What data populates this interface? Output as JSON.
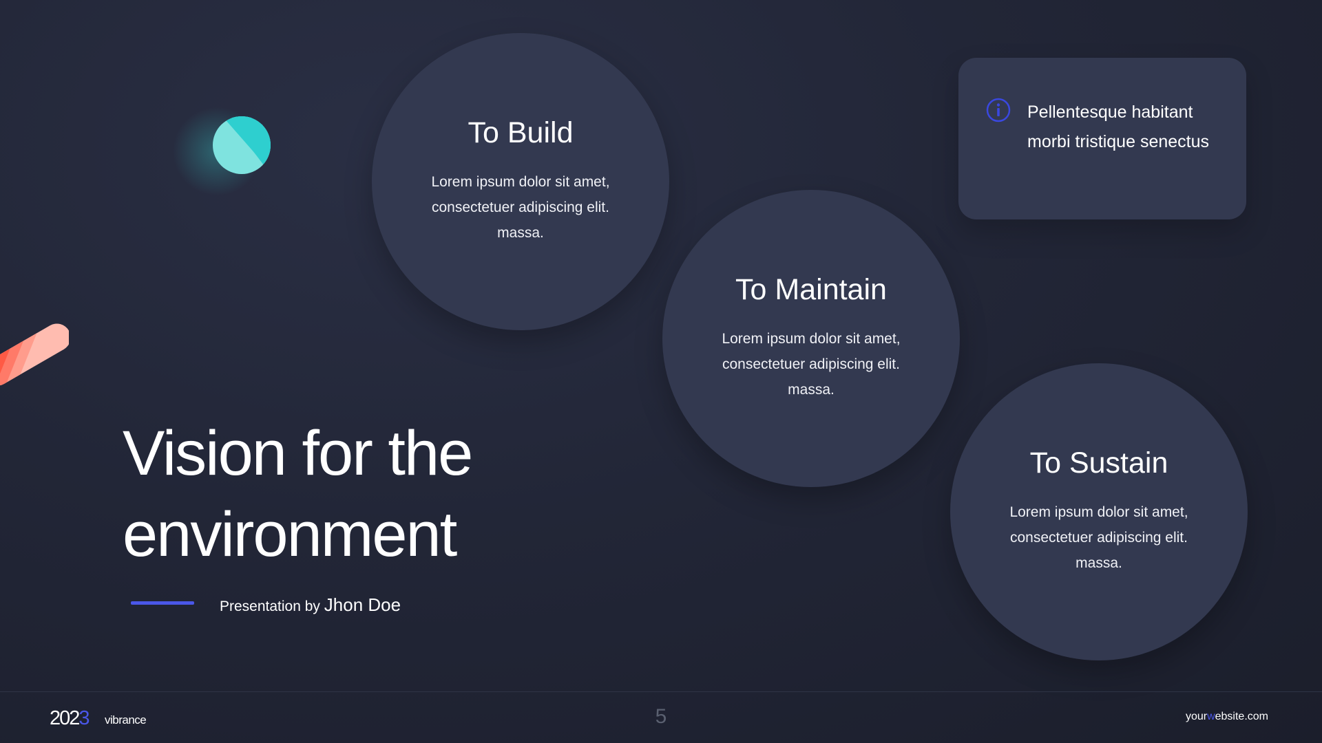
{
  "icons": {
    "info": "info-circle-icon",
    "deco_circle": "decorative-circle-icon",
    "deco_pill": "decorative-pill-icon"
  },
  "colors": {
    "background": "#222637",
    "card": "#333950",
    "accent": "#4a57e8",
    "teal": "#2ecfcf",
    "coral": "#ff6f5e"
  },
  "circles": [
    {
      "title": "To Build",
      "text": "Lorem ipsum dolor sit amet, consectetuer adipiscing elit. massa."
    },
    {
      "title": "To Maintain",
      "text": "Lorem ipsum dolor sit amet, consectetuer adipiscing elit. massa."
    },
    {
      "title": "To Sustain",
      "text": "Lorem ipsum dolor sit amet, consectetuer adipiscing elit. massa."
    }
  ],
  "info_card": {
    "text": "Pellentesque habitant morbi tristique senectus"
  },
  "title": {
    "line1": "Vision for the",
    "line2": "environment"
  },
  "presenter": {
    "prefix": "Presentation by",
    "name": "Jhon Doe"
  },
  "footer": {
    "year_main": "202",
    "year_accent": "3",
    "brand": "vibrance",
    "page_number": "5",
    "website_prefix": "your",
    "website_accent": "w",
    "website_suffix": "ebsite.com"
  }
}
